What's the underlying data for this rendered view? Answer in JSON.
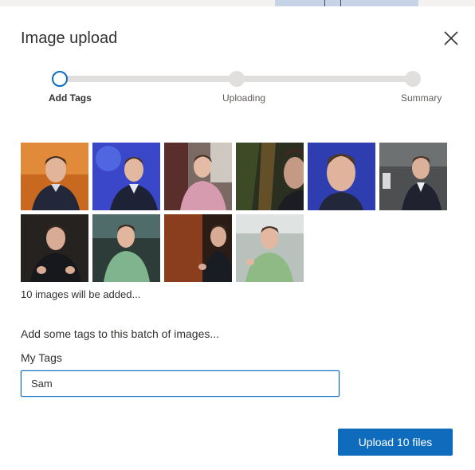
{
  "dialog": {
    "title": "Image upload"
  },
  "stepper": {
    "steps": [
      {
        "label": "Add Tags",
        "state": "active"
      },
      {
        "label": "Uploading",
        "state": "pending"
      },
      {
        "label": "Summary",
        "state": "pending"
      }
    ]
  },
  "thumbnails": {
    "count_note": "10 images will be added...",
    "images": [
      {
        "subject": "portrait-warm-background"
      },
      {
        "subject": "portrait-blue-stage"
      },
      {
        "subject": "portrait-pink-hoodie"
      },
      {
        "subject": "portrait-dark-greenery"
      },
      {
        "subject": "portrait-blue-background-closeup"
      },
      {
        "subject": "portrait-grey-room"
      },
      {
        "subject": "portrait-dark-background"
      },
      {
        "subject": "portrait-green-sweater-gesturing"
      },
      {
        "subject": "portrait-stage-with-mic"
      },
      {
        "subject": "portrait-green-sweater-smiling"
      }
    ]
  },
  "tags": {
    "heading": "Add some tags to this batch of images...",
    "field_label": "My Tags",
    "field_value": "Sam"
  },
  "actions": {
    "upload_label": "Upload 10 files"
  },
  "colors": {
    "accent": "#0f6cbd",
    "track": "#e1dfdd"
  }
}
